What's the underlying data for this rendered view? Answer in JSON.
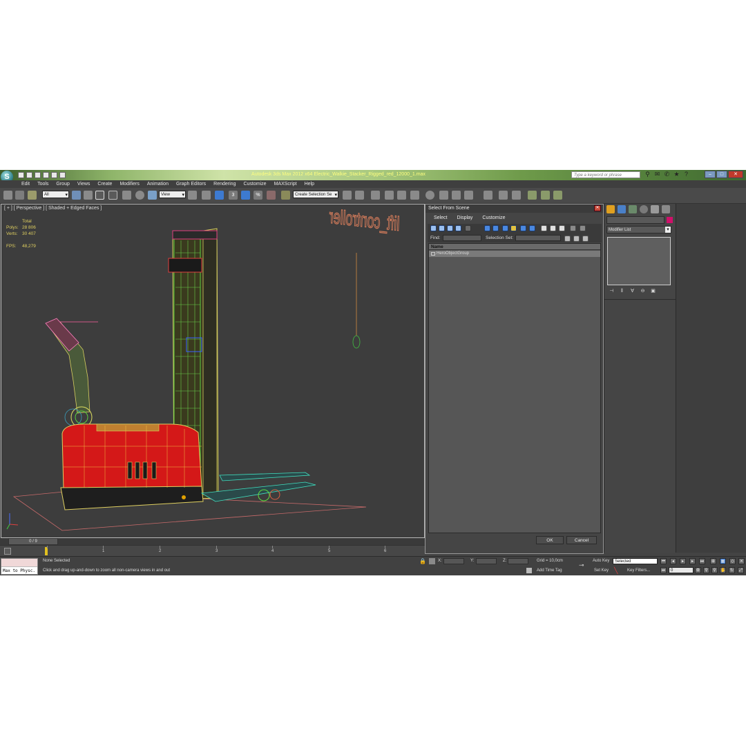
{
  "window": {
    "title": "Autodesk 3ds Max  2012 x64     Electric_Walkie_Stacker_Rigged_red_12000_1.max",
    "search_placeholder": "Type a keyword or phrase"
  },
  "menu": [
    "Edit",
    "Tools",
    "Group",
    "Views",
    "Create",
    "Modifiers",
    "Animation",
    "Graph Editors",
    "Rendering",
    "Customize",
    "MAXScript",
    "Help"
  ],
  "toolbar": {
    "filter_value": "All",
    "ref_coord_value": "View",
    "selection_set_value": "Create Selection Se",
    "snap_angle_label": "3",
    "percent_snap_label": "%"
  },
  "viewport": {
    "label": "[ + ] [ Perspective ] [ Shaded + Edged Faces ]",
    "stats": {
      "total_label": "Total",
      "polys_label": "Polys:",
      "polys_value": "28 806",
      "verts_label": "Verts:",
      "verts_value": "30 407",
      "fps_label": "FPS:",
      "fps_value": "48,279"
    },
    "scene_text": "lift_controller"
  },
  "timeline": {
    "frame_display": "0 / 9",
    "ticks": [
      "1",
      "2",
      "3",
      "4",
      "5",
      "6"
    ]
  },
  "dialog": {
    "title": "Select From Scene",
    "menu": [
      "Select",
      "Display",
      "Customize"
    ],
    "find_label": "Find:",
    "selection_set_label": "Selection Set:",
    "column_name": "Name",
    "rows": [
      "HeroObjectGroup"
    ],
    "ok_label": "OK",
    "cancel_label": "Cancel"
  },
  "command_panel": {
    "modifier_list_label": "Modifier List",
    "object_color": "#d0106a"
  },
  "status_bar": {
    "maxscript_text": "Max to Physc.",
    "selection_status": "None Selected",
    "prompt": "Click and drag up-and-down to zoom all non-camera views in and out",
    "x_label": "X:",
    "y_label": "Y:",
    "z_label": "Z:",
    "grid_text": "Grid = 10,0cm",
    "add_time_tag": "Add Time Tag",
    "auto_key_label": "Auto Key",
    "set_key_label": "Set Key",
    "selected_value": "Selected",
    "key_filters_label": "Key Filters...",
    "current_frame": "0"
  }
}
